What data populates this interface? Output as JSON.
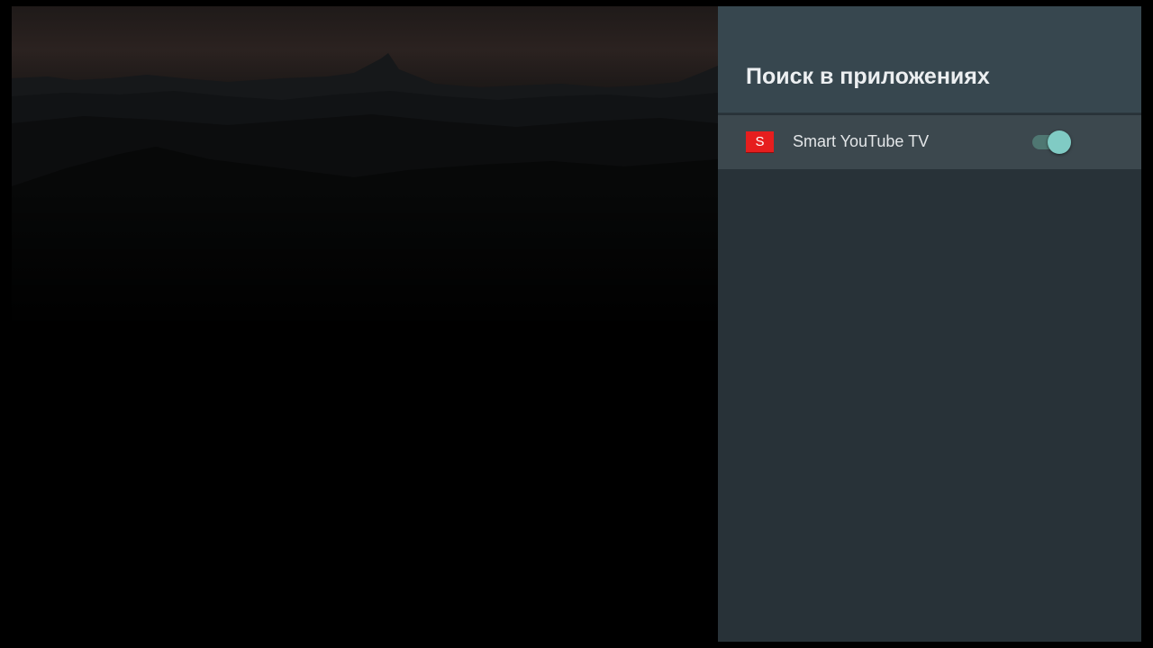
{
  "panel": {
    "title": "Поиск в приложениях",
    "items": [
      {
        "app_name": "Smart YouTube TV",
        "icon_letter": "S",
        "icon": "smart-youtube-tv-app-icon",
        "icon_color": "#e61e1e",
        "enabled": true
      }
    ]
  },
  "colors": {
    "panel_background": "#283238",
    "header_background": "#37474f",
    "selected_row": "#3c484e",
    "toggle_on_thumb": "#80cbc4",
    "toggle_on_track": "#4f7772"
  },
  "background": {
    "image": "dark-mountain-silhouette-wallpaper"
  }
}
